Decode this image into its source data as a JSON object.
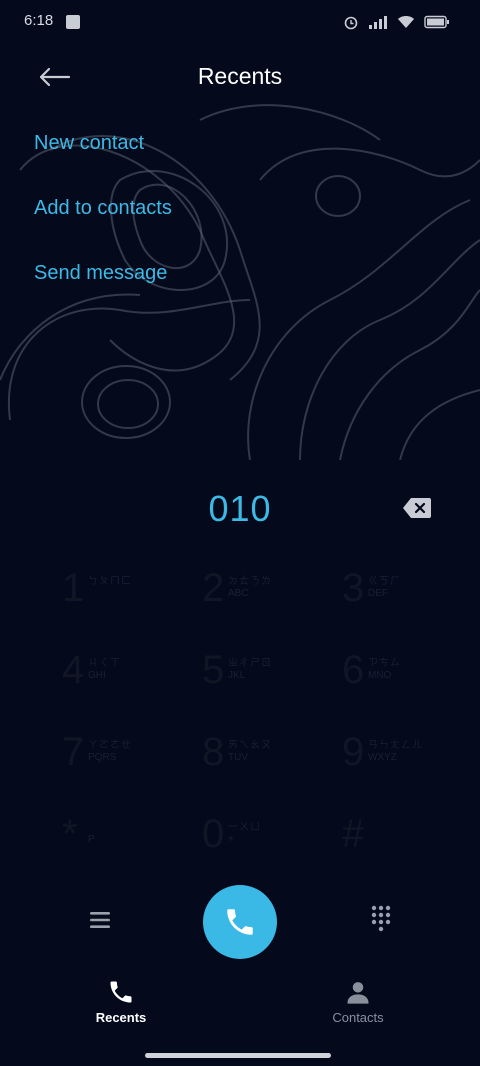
{
  "status_bar": {
    "time": "6:18",
    "icons": [
      "sim-card-icon",
      "alarm-icon",
      "signal-icon",
      "wifi-icon",
      "battery-icon"
    ]
  },
  "header": {
    "title": "Recents",
    "back_icon": "back-arrow-icon"
  },
  "menu": {
    "items": [
      {
        "label": "New contact"
      },
      {
        "label": "Add to contacts"
      },
      {
        "label": "Send message"
      }
    ]
  },
  "dialer": {
    "number": "010",
    "backspace_icon": "backspace-icon",
    "keys": [
      {
        "digit": "1",
        "zh": "ㄅㄆㄇㄈ",
        "en": ""
      },
      {
        "digit": "2",
        "zh": "ㄉㄊㄋㄌ",
        "en": "ABC"
      },
      {
        "digit": "3",
        "zh": "ㄍㄎㄏ",
        "en": "DEF"
      },
      {
        "digit": "4",
        "zh": "ㄐㄑㄒ",
        "en": "GHI"
      },
      {
        "digit": "5",
        "zh": "ㄓㄔㄕㄖ",
        "en": "JKL"
      },
      {
        "digit": "6",
        "zh": "ㄗㄘㄙ",
        "en": "MNO"
      },
      {
        "digit": "7",
        "zh": "ㄚㄛㄜㄝ",
        "en": "PQRS"
      },
      {
        "digit": "8",
        "zh": "ㄞㄟㄠㄡ",
        "en": "TUV"
      },
      {
        "digit": "9",
        "zh": "ㄢㄣㄤㄥㄦ",
        "en": "WXYZ"
      },
      {
        "digit": "*",
        "zh": "",
        "en": "P"
      },
      {
        "digit": "0",
        "zh": "一ㄨㄩ",
        "en": "+"
      },
      {
        "digit": "#",
        "zh": "",
        "en": ""
      }
    ]
  },
  "actions": {
    "menu_icon": "hamburger-menu-icon",
    "call_icon": "phone-icon",
    "dialpad_icon": "dialpad-icon"
  },
  "tabs": [
    {
      "label": "Recents",
      "icon": "phone-icon",
      "active": true
    },
    {
      "label": "Contacts",
      "icon": "person-icon",
      "active": false
    }
  ],
  "colors": {
    "background": "#040a1c",
    "accent": "#3db9e6",
    "active_tab": "#ffffff",
    "inactive_tab": "#8a8f9c"
  }
}
